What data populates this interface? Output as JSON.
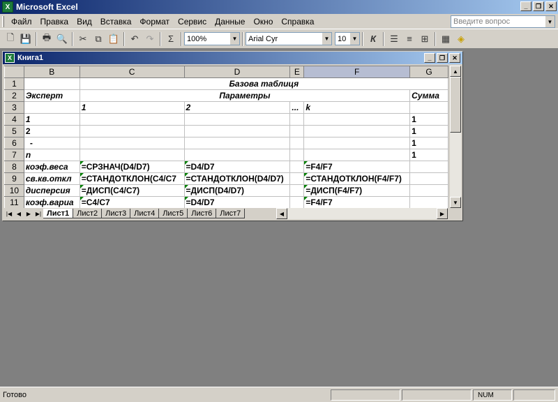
{
  "app": {
    "title": "Microsoft Excel",
    "icon_glyph": "X",
    "min_glyph": "_",
    "restore_glyph": "❐",
    "close_glyph": "✕"
  },
  "menu": {
    "items": [
      "Файл",
      "Правка",
      "Вид",
      "Вставка",
      "Формат",
      "Сервис",
      "Данные",
      "Окно",
      "Справка"
    ],
    "help_placeholder": "Введите вопрос"
  },
  "toolbar": {
    "zoom": "100%",
    "font": "Arial Cyr",
    "font_size": "10",
    "sigma": "Σ",
    "bold_k": "К",
    "icons": [
      "new-icon",
      "save-icon",
      "print-icon",
      "preview-icon",
      "cut-icon",
      "copy-icon",
      "paste-icon",
      "undo-icon",
      "redo-icon",
      "autosum-icon",
      "align-left-icon",
      "align-center-icon",
      "merge-icon",
      "borders-icon",
      "fill-color-icon"
    ]
  },
  "workbook": {
    "title": "Книга1",
    "columns": [
      "B",
      "C",
      "D",
      "E",
      "F",
      "G"
    ],
    "rows": [
      {
        "n": "1",
        "B": "",
        "C": "",
        "D": "Базова таблиця",
        "E": "",
        "F": "",
        "G": ""
      },
      {
        "n": "2",
        "B": "Эксперт",
        "C": "",
        "D": "Параметры",
        "E": "",
        "F": "",
        "G": "Сумма"
      },
      {
        "n": "3",
        "B": "",
        "C": "1",
        "D": "2",
        "E": "...",
        "F": "k",
        "G": ""
      },
      {
        "n": "4",
        "B": "1",
        "C": "",
        "D": "",
        "E": "",
        "F": "",
        "G": "1"
      },
      {
        "n": "5",
        "B": "2",
        "C": "",
        "D": "",
        "E": "",
        "F": "",
        "G": "1"
      },
      {
        "n": "6",
        "B": "-",
        "C": "",
        "D": "",
        "E": "",
        "F": "",
        "G": "1"
      },
      {
        "n": "7",
        "B": "n",
        "C": "",
        "D": "",
        "E": "",
        "F": "",
        "G": "1"
      },
      {
        "n": "8",
        "B": "коэф.веса",
        "C": "=СРЗНАЧ(D4/D7)",
        "D": "=D4/D7",
        "E": "",
        "F": "=F4/F7",
        "G": ""
      },
      {
        "n": "9",
        "B": "св.кв.откл",
        "C": "=СТАНДОТКЛОН(C4/C7",
        "D": "=СТАНДОТКЛОН(D4/D7)",
        "E": "",
        "F": "=СТАНДОТКЛОН(F4/F7)",
        "G": ""
      },
      {
        "n": "10",
        "B": "дисперсия",
        "C": "=ДИСП(C4/C7)",
        "D": "=ДИСП(D4/D7)",
        "E": "",
        "F": "=ДИСП(F4/F7)",
        "G": ""
      },
      {
        "n": "11",
        "B": "коэф.вариа",
        "C": "=C4/C7",
        "D": "=D4/D7",
        "E": "",
        "F": "=F4/F7",
        "G": ""
      }
    ],
    "tabs": [
      "Лист1",
      "Лист2",
      "Лист3",
      "Лист4",
      "Лист5",
      "Лист6",
      "Лист7"
    ],
    "active_tab": "Лист1"
  },
  "status": {
    "text": "Готово",
    "num": "NUM"
  }
}
